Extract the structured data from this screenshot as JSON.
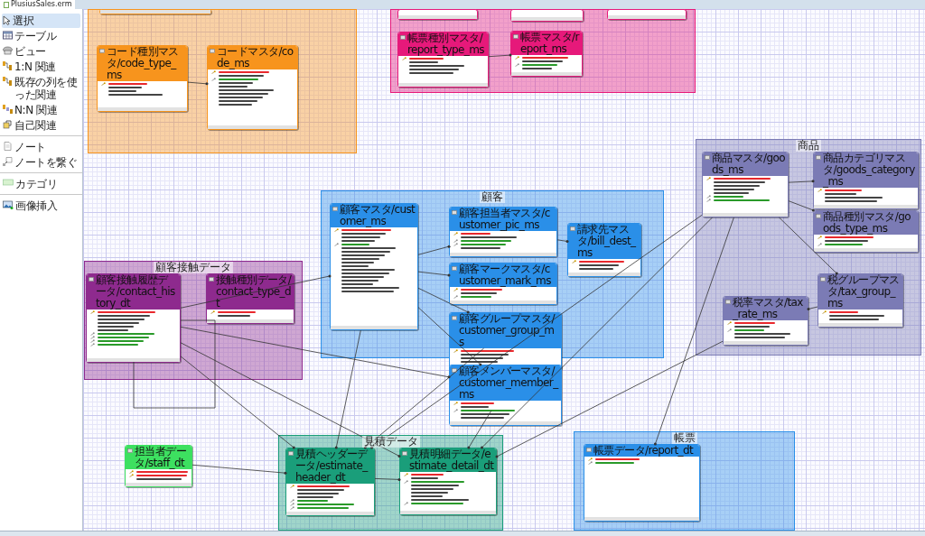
{
  "editor_tab": {
    "title": "PlusiusSales.erm"
  },
  "palette": {
    "groups": [
      [
        {
          "kind": "select",
          "label": "選択",
          "selected": true
        },
        {
          "kind": "table",
          "label": "テーブル",
          "selected": false
        },
        {
          "kind": "view",
          "label": "ビュー",
          "selected": false
        },
        {
          "kind": "relation",
          "label": "1:N 関連",
          "selected": false
        },
        {
          "kind": "relation",
          "label": "既存の列を使った関連",
          "selected": false
        },
        {
          "kind": "nn",
          "label": "N:N 関連",
          "selected": false
        },
        {
          "kind": "self",
          "label": "自己関連",
          "selected": false
        }
      ],
      [
        {
          "kind": "note",
          "label": "ノート",
          "selected": false
        },
        {
          "kind": "noteconn",
          "label": "ノートを繋ぐ",
          "selected": false
        }
      ],
      [
        {
          "kind": "category",
          "label": "カテゴリ",
          "selected": false
        }
      ],
      [
        {
          "kind": "image",
          "label": "画像挿入",
          "selected": false
        }
      ]
    ]
  },
  "categories": [
    {
      "color": "#f7941d",
      "tables": [
        {
          "kind": "stub"
        },
        {
          "kind": "table",
          "title": "コード種別マスタ/code_type_ms",
          "columns": [
            {
              "kind": "pk"
            },
            {
              "kind": "plain"
            },
            {
              "kind": "plain"
            },
            {
              "kind": "plain"
            }
          ]
        },
        {
          "kind": "table",
          "title": "コードマスタ/code_ms",
          "columns": [
            {
              "kind": "pk"
            },
            {
              "kind": "plain"
            },
            {
              "kind": "fk"
            },
            {
              "kind": "plain"
            },
            {
              "kind": "plain"
            },
            {
              "kind": "plain"
            },
            {
              "kind": "plain"
            },
            {
              "kind": "plain"
            },
            {
              "kind": "plain"
            },
            {
              "kind": "plain"
            }
          ]
        }
      ]
    },
    {
      "color": "#e6197a",
      "tables": [
        {
          "kind": "stub"
        },
        {
          "kind": "stub"
        },
        {
          "kind": "stub"
        },
        {
          "kind": "table",
          "title": "帳票種別マスタ/report_type_ms",
          "columns": [
            {
              "kind": "pk"
            },
            {
              "kind": "plain"
            },
            {
              "kind": "plain"
            },
            {
              "kind": "plain"
            },
            {
              "kind": "plain"
            }
          ]
        },
        {
          "kind": "table",
          "title": "帳票マスタ/report_ms",
          "columns": [
            {
              "kind": "pk"
            },
            {
              "kind": "plain"
            },
            {
              "kind": "fk"
            },
            {
              "kind": "plain"
            }
          ]
        }
      ]
    },
    {
      "label": "顧客接触データ",
      "color": "#8e2a8e",
      "tables": [
        {
          "kind": "table",
          "title": "顧客接触履歴データ/contact_history_dt",
          "columns": [
            {
              "kind": "pk"
            },
            {
              "kind": "plain"
            },
            {
              "kind": "plain"
            },
            {
              "kind": "plain"
            },
            {
              "kind": "plain"
            },
            {
              "kind": "plain"
            },
            {
              "kind": "fk"
            },
            {
              "kind": "fk"
            },
            {
              "kind": "fk"
            },
            {
              "kind": "fk"
            }
          ]
        },
        {
          "kind": "table",
          "title": "接触種別データ/contact_type_dt",
          "columns": [
            {
              "kind": "pk"
            },
            {
              "kind": "plain"
            }
          ]
        }
      ]
    },
    {
      "label": "顧客",
      "color": "#2a8fe8",
      "tables": [
        {
          "kind": "table",
          "title": "顧客マスタ/customer_ms",
          "columns": [
            {
              "kind": "pk"
            },
            {
              "kind": "plain"
            },
            {
              "kind": "plain"
            },
            {
              "kind": "plain"
            },
            {
              "kind": "fk"
            },
            {
              "kind": "plain"
            },
            {
              "kind": "plain"
            },
            {
              "kind": "plain"
            },
            {
              "kind": "plain"
            },
            {
              "kind": "plain"
            },
            {
              "kind": "plain"
            },
            {
              "kind": "plain"
            },
            {
              "kind": "plain"
            },
            {
              "kind": "plain"
            },
            {
              "kind": "plain"
            },
            {
              "kind": "plain"
            },
            {
              "kind": "plain"
            },
            {
              "kind": "plain"
            }
          ]
        },
        {
          "kind": "table",
          "title": "顧客担当者マスタ/customer_pic_ms",
          "columns": [
            {
              "kind": "pk"
            },
            {
              "kind": "plain"
            },
            {
              "kind": "fk"
            },
            {
              "kind": "fk"
            },
            {
              "kind": "plain"
            }
          ]
        },
        {
          "kind": "table",
          "title": "顧客マークマスタ/customer_mark_ms",
          "columns": [
            {
              "kind": "pk"
            },
            {
              "kind": "plain"
            },
            {
              "kind": "fk"
            }
          ]
        },
        {
          "kind": "table",
          "title": "顧客グループマスタ/customer_group_ms",
          "columns": [
            {
              "kind": "pk"
            },
            {
              "kind": "plain"
            },
            {
              "kind": "plain"
            },
            {
              "kind": "plain"
            }
          ]
        },
        {
          "kind": "table",
          "title": "顧客メンバーマスタ/customer_member_ms",
          "columns": [
            {
              "kind": "pk"
            },
            {
              "kind": "plain"
            },
            {
              "kind": "fk"
            },
            {
              "kind": "plain"
            },
            {
              "kind": "plain"
            }
          ]
        },
        {
          "kind": "table",
          "title": "請求先マスタ/bill_dest_ms",
          "columns": [
            {
              "kind": "pk"
            },
            {
              "kind": "plain"
            },
            {
              "kind": "plain"
            }
          ]
        }
      ]
    },
    {
      "label": "商品",
      "color": "#7b7bb5",
      "tables": [
        {
          "kind": "table",
          "title": "商品マスタ/goods_ms",
          "columns": [
            {
              "kind": "pk"
            },
            {
              "kind": "plain"
            },
            {
              "kind": "plain"
            },
            {
              "kind": "plain"
            },
            {
              "kind": "plain"
            },
            {
              "kind": "fk"
            },
            {
              "kind": "fk"
            }
          ]
        },
        {
          "kind": "table",
          "title": "商品カテゴリマスタ/goods_category_ms",
          "columns": [
            {
              "kind": "pk"
            },
            {
              "kind": "plain"
            },
            {
              "kind": "plain"
            },
            {
              "kind": "plain"
            }
          ]
        },
        {
          "kind": "table",
          "title": "商品種別マスタ/goods_type_ms",
          "columns": [
            {
              "kind": "pk"
            },
            {
              "kind": "plain"
            },
            {
              "kind": "fk"
            }
          ]
        },
        {
          "kind": "table",
          "title": "税グループマスタ/tax_group_ms",
          "columns": [
            {
              "kind": "pk"
            },
            {
              "kind": "plain"
            },
            {
              "kind": "plain"
            }
          ]
        },
        {
          "kind": "table",
          "title": "税率マスタ/tax_rate_ms",
          "columns": [
            {
              "kind": "pk"
            },
            {
              "kind": "plain"
            },
            {
              "kind": "fk"
            },
            {
              "kind": "plain"
            },
            {
              "kind": "plain"
            }
          ]
        }
      ]
    },
    {
      "label": "見積データ",
      "color": "#1a9e7a",
      "tables": [
        {
          "kind": "table",
          "title": "見積ヘッダーデータ/estimate_header_dt",
          "columns": [
            {
              "kind": "pk"
            },
            {
              "kind": "plain"
            },
            {
              "kind": "plain"
            },
            {
              "kind": "plain"
            },
            {
              "kind": "fk"
            },
            {
              "kind": "fk"
            },
            {
              "kind": "fk"
            }
          ]
        },
        {
          "kind": "table",
          "title": "見積明細データ/estimate_detail_dt",
          "columns": [
            {
              "kind": "pk"
            },
            {
              "kind": "plain"
            },
            {
              "kind": "fk"
            },
            {
              "kind": "plain"
            },
            {
              "kind": "plain"
            },
            {
              "kind": "plain"
            },
            {
              "kind": "plain"
            },
            {
              "kind": "plain"
            },
            {
              "kind": "fk"
            }
          ]
        }
      ]
    },
    {
      "label": "帳票",
      "color": "#2a8fe8",
      "tables": [
        {
          "kind": "table",
          "title": "帳票データ/report_dt",
          "columns": [
            {
              "kind": "pk"
            },
            {
              "kind": "fk"
            }
          ]
        }
      ]
    }
  ],
  "tables": [
    {
      "kind": "table",
      "color": "#3de060",
      "title": "担当者データ/staff_dt",
      "columns": [
        {
          "kind": "pk"
        },
        {
          "kind": "pk"
        },
        {
          "kind": "plain"
        }
      ]
    }
  ]
}
